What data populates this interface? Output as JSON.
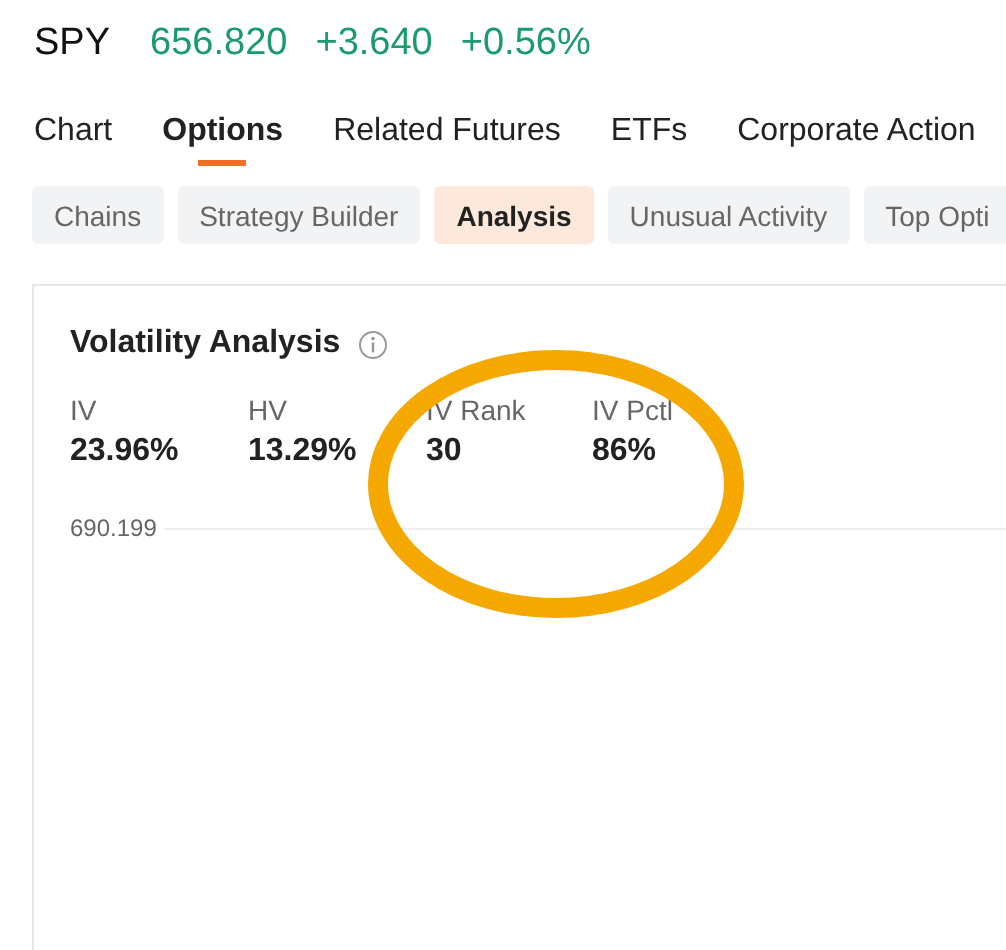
{
  "quote": {
    "symbol": "SPY",
    "price": "656.820",
    "change": "+3.640",
    "change_percent": "+0.56%"
  },
  "tabs": [
    {
      "label": "Chart",
      "selected": false
    },
    {
      "label": "Options",
      "selected": true
    },
    {
      "label": "Related Futures",
      "selected": false
    },
    {
      "label": "ETFs",
      "selected": false
    },
    {
      "label": "Corporate Action",
      "selected": false
    }
  ],
  "subtabs": [
    {
      "label": "Chains",
      "selected": false
    },
    {
      "label": "Strategy Builder",
      "selected": false
    },
    {
      "label": "Analysis",
      "selected": true
    },
    {
      "label": "Unusual Activity",
      "selected": false
    },
    {
      "label": "Top Opti",
      "selected": false
    }
  ],
  "card": {
    "title": "Volatility Analysis",
    "metrics": [
      {
        "label": "IV",
        "value": "23.96%"
      },
      {
        "label": "HV",
        "value": "13.29%"
      },
      {
        "label": "IV Rank",
        "value": "30"
      },
      {
        "label": "IV Pctl",
        "value": "86%"
      }
    ],
    "axis_label": "690.199"
  }
}
